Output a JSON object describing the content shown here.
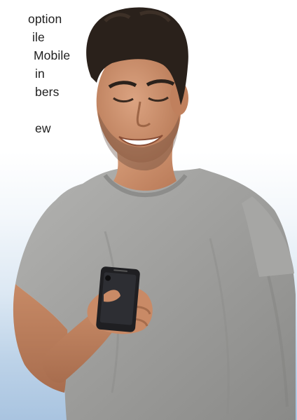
{
  "promo": {
    "lines": [
      "option",
      "ile",
      "Mobile",
      "in",
      "bers",
      "ew"
    ]
  },
  "image": {
    "subject": "smiling man in gray t-shirt holding smartphone"
  },
  "colors": {
    "text": "#1e1e1e",
    "shirt": "#9c9c9a",
    "skin": "#c98d6a",
    "hair": "#2a211b",
    "phone": "#1f1f22",
    "background_bottom": "#a9c4e0"
  }
}
